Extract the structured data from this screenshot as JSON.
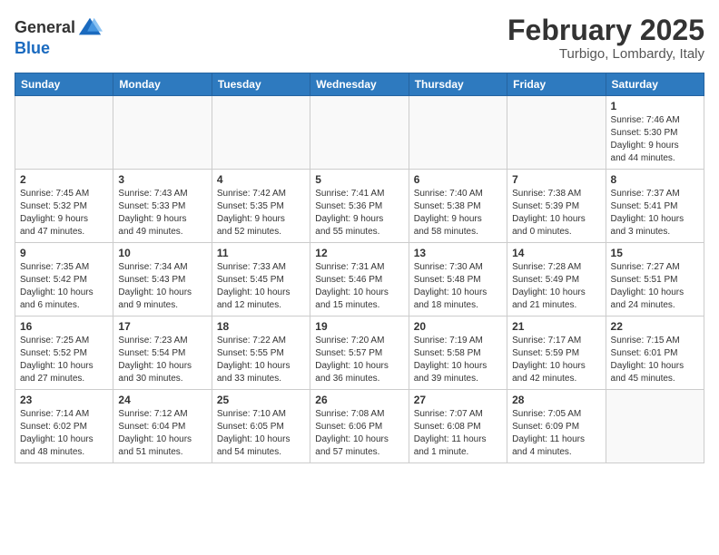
{
  "header": {
    "logo_general": "General",
    "logo_blue": "Blue",
    "month": "February 2025",
    "location": "Turbigo, Lombardy, Italy"
  },
  "weekdays": [
    "Sunday",
    "Monday",
    "Tuesday",
    "Wednesday",
    "Thursday",
    "Friday",
    "Saturday"
  ],
  "weeks": [
    [
      {
        "day": "",
        "info": ""
      },
      {
        "day": "",
        "info": ""
      },
      {
        "day": "",
        "info": ""
      },
      {
        "day": "",
        "info": ""
      },
      {
        "day": "",
        "info": ""
      },
      {
        "day": "",
        "info": ""
      },
      {
        "day": "1",
        "info": "Sunrise: 7:46 AM\nSunset: 5:30 PM\nDaylight: 9 hours\nand 44 minutes."
      }
    ],
    [
      {
        "day": "2",
        "info": "Sunrise: 7:45 AM\nSunset: 5:32 PM\nDaylight: 9 hours\nand 47 minutes."
      },
      {
        "day": "3",
        "info": "Sunrise: 7:43 AM\nSunset: 5:33 PM\nDaylight: 9 hours\nand 49 minutes."
      },
      {
        "day": "4",
        "info": "Sunrise: 7:42 AM\nSunset: 5:35 PM\nDaylight: 9 hours\nand 52 minutes."
      },
      {
        "day": "5",
        "info": "Sunrise: 7:41 AM\nSunset: 5:36 PM\nDaylight: 9 hours\nand 55 minutes."
      },
      {
        "day": "6",
        "info": "Sunrise: 7:40 AM\nSunset: 5:38 PM\nDaylight: 9 hours\nand 58 minutes."
      },
      {
        "day": "7",
        "info": "Sunrise: 7:38 AM\nSunset: 5:39 PM\nDaylight: 10 hours\nand 0 minutes."
      },
      {
        "day": "8",
        "info": "Sunrise: 7:37 AM\nSunset: 5:41 PM\nDaylight: 10 hours\nand 3 minutes."
      }
    ],
    [
      {
        "day": "9",
        "info": "Sunrise: 7:35 AM\nSunset: 5:42 PM\nDaylight: 10 hours\nand 6 minutes."
      },
      {
        "day": "10",
        "info": "Sunrise: 7:34 AM\nSunset: 5:43 PM\nDaylight: 10 hours\nand 9 minutes."
      },
      {
        "day": "11",
        "info": "Sunrise: 7:33 AM\nSunset: 5:45 PM\nDaylight: 10 hours\nand 12 minutes."
      },
      {
        "day": "12",
        "info": "Sunrise: 7:31 AM\nSunset: 5:46 PM\nDaylight: 10 hours\nand 15 minutes."
      },
      {
        "day": "13",
        "info": "Sunrise: 7:30 AM\nSunset: 5:48 PM\nDaylight: 10 hours\nand 18 minutes."
      },
      {
        "day": "14",
        "info": "Sunrise: 7:28 AM\nSunset: 5:49 PM\nDaylight: 10 hours\nand 21 minutes."
      },
      {
        "day": "15",
        "info": "Sunrise: 7:27 AM\nSunset: 5:51 PM\nDaylight: 10 hours\nand 24 minutes."
      }
    ],
    [
      {
        "day": "16",
        "info": "Sunrise: 7:25 AM\nSunset: 5:52 PM\nDaylight: 10 hours\nand 27 minutes."
      },
      {
        "day": "17",
        "info": "Sunrise: 7:23 AM\nSunset: 5:54 PM\nDaylight: 10 hours\nand 30 minutes."
      },
      {
        "day": "18",
        "info": "Sunrise: 7:22 AM\nSunset: 5:55 PM\nDaylight: 10 hours\nand 33 minutes."
      },
      {
        "day": "19",
        "info": "Sunrise: 7:20 AM\nSunset: 5:57 PM\nDaylight: 10 hours\nand 36 minutes."
      },
      {
        "day": "20",
        "info": "Sunrise: 7:19 AM\nSunset: 5:58 PM\nDaylight: 10 hours\nand 39 minutes."
      },
      {
        "day": "21",
        "info": "Sunrise: 7:17 AM\nSunset: 5:59 PM\nDaylight: 10 hours\nand 42 minutes."
      },
      {
        "day": "22",
        "info": "Sunrise: 7:15 AM\nSunset: 6:01 PM\nDaylight: 10 hours\nand 45 minutes."
      }
    ],
    [
      {
        "day": "23",
        "info": "Sunrise: 7:14 AM\nSunset: 6:02 PM\nDaylight: 10 hours\nand 48 minutes."
      },
      {
        "day": "24",
        "info": "Sunrise: 7:12 AM\nSunset: 6:04 PM\nDaylight: 10 hours\nand 51 minutes."
      },
      {
        "day": "25",
        "info": "Sunrise: 7:10 AM\nSunset: 6:05 PM\nDaylight: 10 hours\nand 54 minutes."
      },
      {
        "day": "26",
        "info": "Sunrise: 7:08 AM\nSunset: 6:06 PM\nDaylight: 10 hours\nand 57 minutes."
      },
      {
        "day": "27",
        "info": "Sunrise: 7:07 AM\nSunset: 6:08 PM\nDaylight: 11 hours\nand 1 minute."
      },
      {
        "day": "28",
        "info": "Sunrise: 7:05 AM\nSunset: 6:09 PM\nDaylight: 11 hours\nand 4 minutes."
      },
      {
        "day": "",
        "info": ""
      }
    ]
  ]
}
